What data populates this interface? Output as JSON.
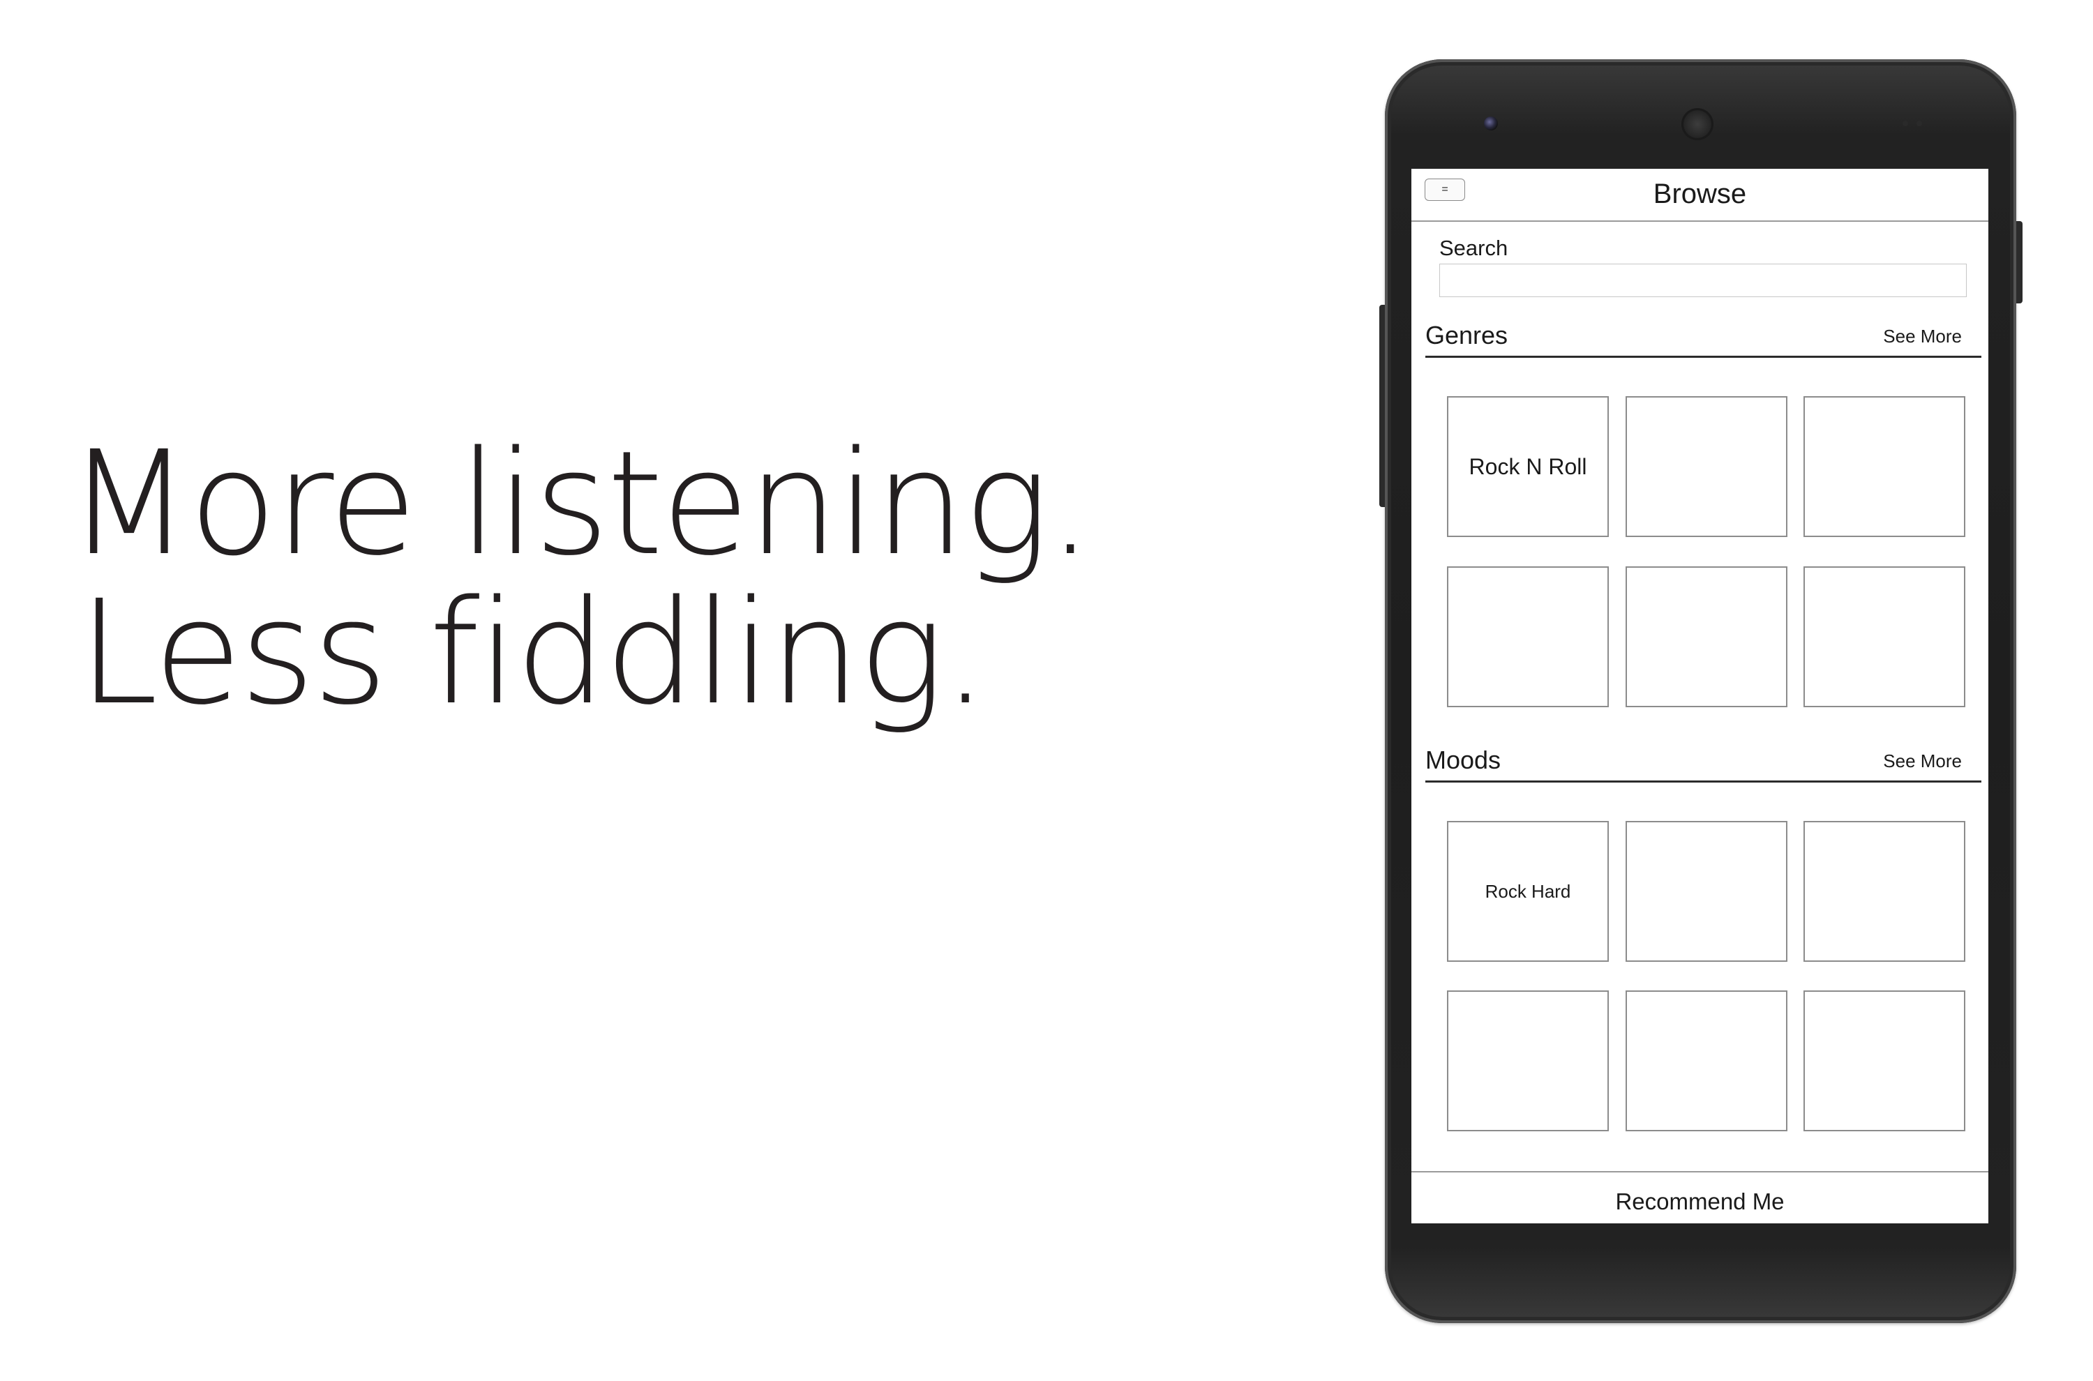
{
  "tagline": {
    "line1": "More listening.",
    "line2": "Less fiddling."
  },
  "app": {
    "header": {
      "menu_label": "=",
      "title": "Browse"
    },
    "search": {
      "label": "Search",
      "value": "",
      "placeholder": ""
    },
    "genres": {
      "title": "Genres",
      "see_more": "See More",
      "tiles": [
        "Rock N Roll",
        "",
        "",
        "",
        "",
        ""
      ]
    },
    "moods": {
      "title": "Moods",
      "see_more": "See More",
      "tiles": [
        "Rock Hard",
        "",
        "",
        "",
        "",
        ""
      ]
    },
    "footer": {
      "button_label": "Recommend Me"
    }
  },
  "colors": {
    "tagline_text": "#231f20",
    "phone_body": "#1e1e1e",
    "screen_bg": "#ffffff",
    "tile_border": "#8c8c8c"
  }
}
